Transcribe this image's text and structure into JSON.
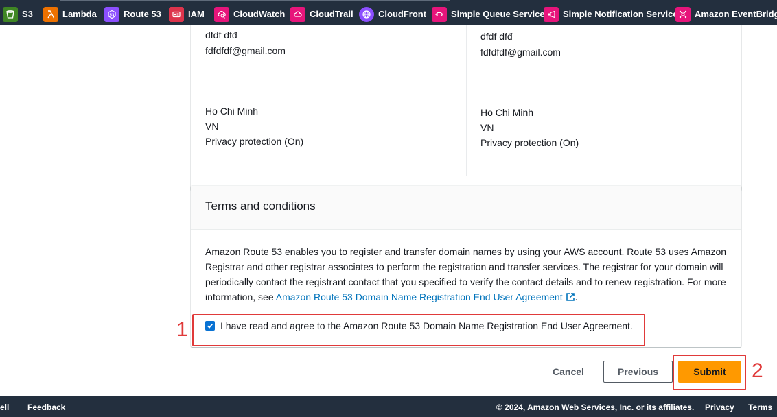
{
  "favorites": [
    {
      "label": "S3",
      "icon": "s3-bucket-icon",
      "color": "#3f8624"
    },
    {
      "label": "Lambda",
      "icon": "lambda-icon",
      "color": "#ed7100"
    },
    {
      "label": "Route 53",
      "icon": "route53-icon",
      "color": "#8c4fff"
    },
    {
      "label": "IAM",
      "icon": "iam-icon",
      "color": "#dd344c"
    },
    {
      "label": "CloudWatch",
      "icon": "cloudwatch-icon",
      "color": "#e7157b"
    },
    {
      "label": "CloudTrail",
      "icon": "cloudtrail-icon",
      "color": "#e7157b"
    },
    {
      "label": "CloudFront",
      "icon": "cloudfront-icon",
      "color": "#8c4fff"
    },
    {
      "label": "Simple Queue Service",
      "icon": "sqs-icon",
      "color": "#e7157b"
    },
    {
      "label": "Simple Notification Service",
      "icon": "sns-icon",
      "color": "#e7157b"
    },
    {
      "label": "Amazon EventBridge",
      "icon": "eventbridge-icon",
      "color": "#e7157b"
    }
  ],
  "contacts": {
    "left": {
      "name": "dfdf dfđ",
      "email": "fdfdfdf@gmail.com",
      "city": "Ho Chi Minh",
      "country": "VN",
      "privacy": "Privacy protection (On)"
    },
    "right": {
      "name": "dfdf dfđ",
      "email": "fdfdfdf@gmail.com",
      "city": "Ho Chi Minh",
      "country": "VN",
      "privacy": "Privacy protection (On)"
    }
  },
  "terms": {
    "title": "Terms and conditions",
    "body_text": "Amazon Route 53 enables you to register and transfer domain names by using your AWS account. Route 53 uses Amazon Registrar and other registrar associates to perform the registration and transfer services. The registrar for your domain will periodically contact the registrant contact that you specified to verify the contact details and to renew registration. For more information, see ",
    "link_text": "Amazon Route 53 Domain Name Registration End User Agreement",
    "trailing": ".",
    "agree_label": "I have read and agree to the Amazon Route 53 Domain Name Registration End User Agreement.",
    "agree_checked": true
  },
  "actions": {
    "cancel": "Cancel",
    "previous": "Previous",
    "submit": "Submit"
  },
  "annotations": {
    "one": "1",
    "two": "2"
  },
  "footer": {
    "cloudshell": "ell",
    "feedback": "Feedback",
    "copyright": "© 2024, Amazon Web Services, Inc. or its affiliates.",
    "privacy": "Privacy",
    "terms": "Terms"
  },
  "colors": {
    "nav_bg": "#232f3e",
    "primary_button": "#ff9900",
    "link": "#0073bb",
    "annotation": "#e03a3a",
    "checkbox": "#0972d3"
  }
}
